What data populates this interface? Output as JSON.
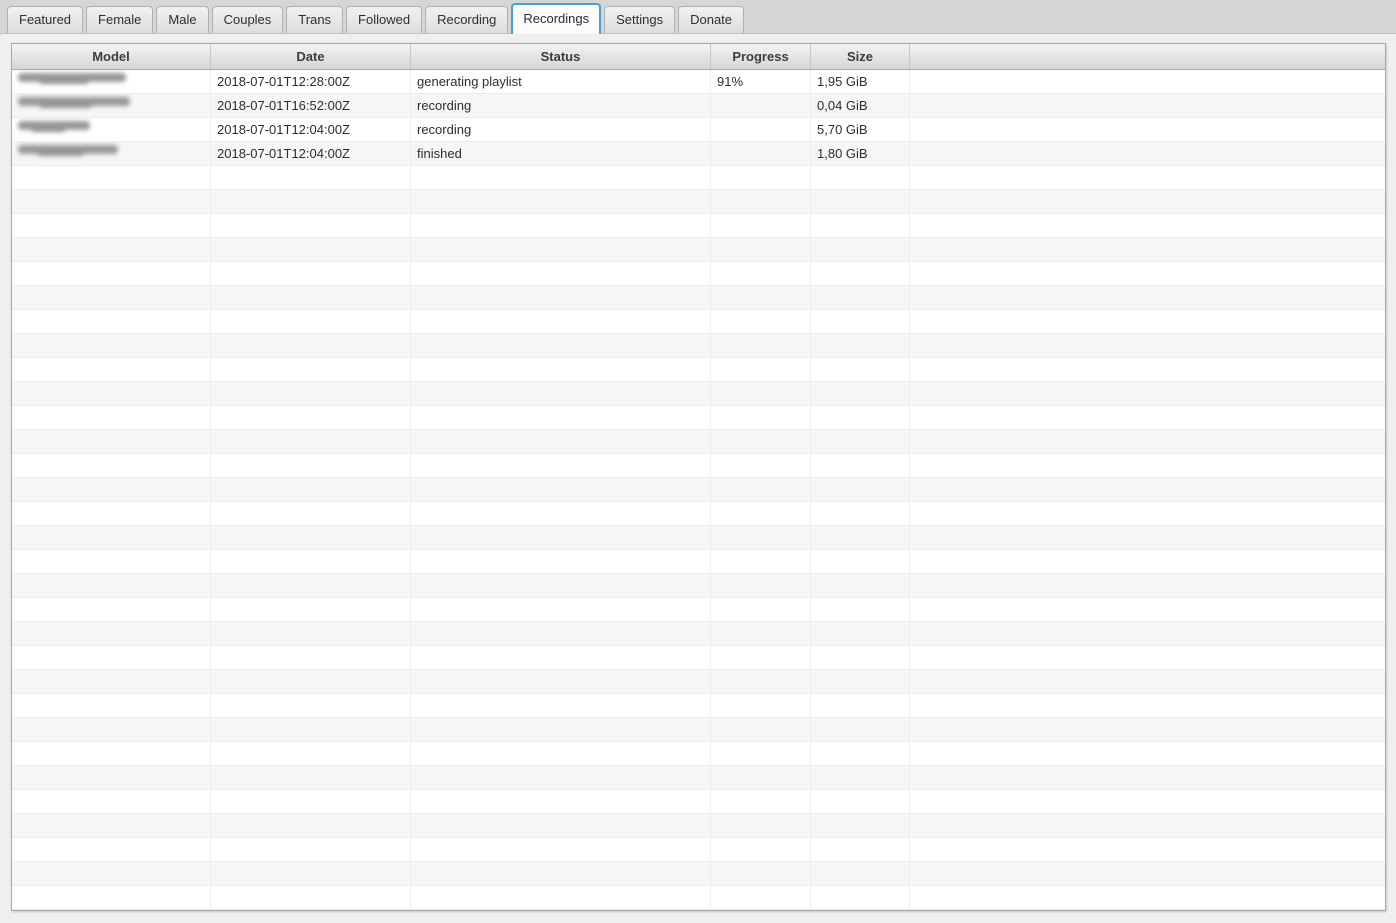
{
  "colors": {
    "accent": "#4b9fd5",
    "tabstrip_background": "#d6d6d6",
    "content_background": "#efefef",
    "row_stripe": "#f6f6f6",
    "table_border": "#a6a6a6",
    "header_text": "#3d3d3d",
    "cell_text": "#2d2d2d"
  },
  "tabs": [
    {
      "label": "Featured",
      "active": false
    },
    {
      "label": "Female",
      "active": false
    },
    {
      "label": "Male",
      "active": false
    },
    {
      "label": "Couples",
      "active": false
    },
    {
      "label": "Trans",
      "active": false
    },
    {
      "label": "Followed",
      "active": false
    },
    {
      "label": "Recording",
      "active": false
    },
    {
      "label": "Recordings",
      "active": true
    },
    {
      "label": "Settings",
      "active": false
    },
    {
      "label": "Donate",
      "active": false
    }
  ],
  "table": {
    "columns": [
      {
        "label": "Model"
      },
      {
        "label": "Date"
      },
      {
        "label": "Status"
      },
      {
        "label": "Progress"
      },
      {
        "label": "Size"
      },
      {
        "label": ""
      }
    ],
    "rows": [
      {
        "model_redacted": true,
        "model_blur_width": 108,
        "date": "2018-07-01T12:28:00Z",
        "status": "generating playlist",
        "progress": "91%",
        "size": "1,95 GiB"
      },
      {
        "model_redacted": true,
        "model_blur_width": 112,
        "date": "2018-07-01T16:52:00Z",
        "status": "recording",
        "progress": "",
        "size": "0,04 GiB"
      },
      {
        "model_redacted": true,
        "model_blur_width": 72,
        "date": "2018-07-01T12:04:00Z",
        "status": "recording",
        "progress": "",
        "size": "5,70 GiB"
      },
      {
        "model_redacted": true,
        "model_blur_width": 100,
        "date": "2018-07-01T12:04:00Z",
        "status": "finished",
        "progress": "",
        "size": "1,80 GiB"
      }
    ],
    "empty_row_count": 31
  }
}
